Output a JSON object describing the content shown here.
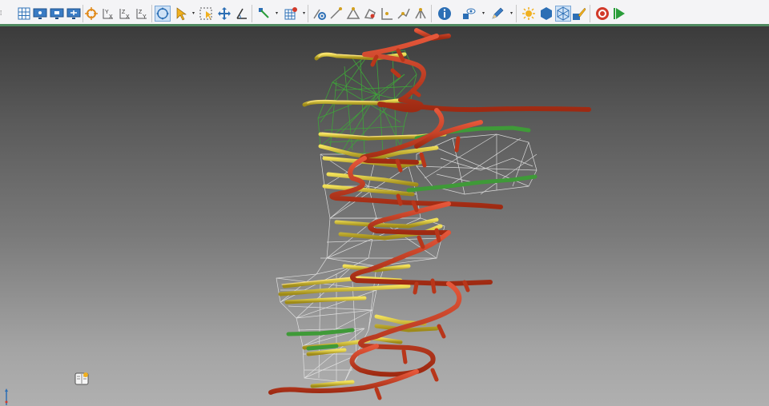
{
  "toolbar": {
    "buttons": [
      {
        "id": "grid-view",
        "icon": "grid-icon"
      },
      {
        "id": "monitor-1",
        "icon": "monitor-icon"
      },
      {
        "id": "monitor-2",
        "icon": "monitor-icon"
      },
      {
        "id": "monitor-3",
        "icon": "monitor-icon"
      },
      {
        "id": "target",
        "icon": "crosshair-icon"
      },
      {
        "id": "view-yx",
        "icon": "axis-yx-icon"
      },
      {
        "id": "view-zx",
        "icon": "axis-zx-icon"
      },
      {
        "id": "view-zy",
        "icon": "axis-zy-icon"
      },
      {
        "id": "orbit",
        "icon": "orbit-icon",
        "active": true
      },
      {
        "id": "select",
        "icon": "pointer-icon"
      },
      {
        "id": "box-select",
        "icon": "box-select-icon"
      },
      {
        "id": "pan",
        "icon": "move-icon"
      },
      {
        "id": "measure",
        "icon": "angle-icon"
      },
      {
        "id": "snap",
        "icon": "snap-icon"
      },
      {
        "id": "grid-add",
        "icon": "grid-add-icon"
      },
      {
        "id": "digitize-1",
        "icon": "digitize-icon"
      },
      {
        "id": "digitize-2",
        "icon": "polyline-icon"
      },
      {
        "id": "digitize-3",
        "icon": "triangle-icon"
      },
      {
        "id": "digitize-4",
        "icon": "polygon-icon"
      },
      {
        "id": "digitize-5",
        "icon": "axis-points-icon"
      },
      {
        "id": "digitize-6",
        "icon": "branch-icon"
      },
      {
        "id": "info",
        "icon": "info-icon"
      },
      {
        "id": "visibility",
        "icon": "eye-icon"
      },
      {
        "id": "edit",
        "icon": "pencil-icon"
      },
      {
        "id": "lighting",
        "icon": "sun-icon"
      },
      {
        "id": "solid",
        "icon": "hexagon-icon"
      },
      {
        "id": "wireframe",
        "icon": "wireframe-icon",
        "active": true
      },
      {
        "id": "paint",
        "icon": "paint-icon"
      },
      {
        "id": "record",
        "icon": "target-icon"
      },
      {
        "id": "play",
        "icon": "play-icon"
      }
    ]
  },
  "scene": {
    "colors": {
      "red_tube": "#c8391c",
      "yellow_tube": "#c9b52a",
      "green_tube": "#3f9a38",
      "green_mesh": "#3fa33a",
      "white_mesh": "#e6e6e6",
      "highlight": "#ffe38a"
    }
  }
}
